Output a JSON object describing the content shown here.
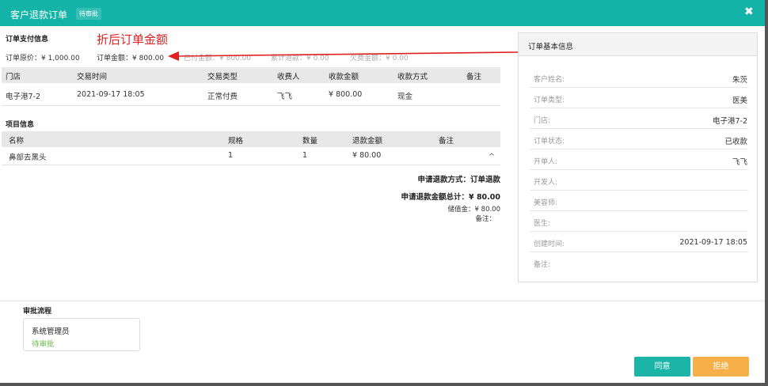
{
  "header": {
    "title": "客户退款订单",
    "badge": "待审批",
    "close": "✖"
  },
  "annotation": "折后订单金额",
  "payment": {
    "section_title": "订单支付信息",
    "original_price": "订单原价：¥ 1,000.00",
    "order_amount": "订单金额：¥ 800.00",
    "ghost_1": "已付金额：¥ 800.00",
    "ghost_2": "累计退款：¥ 0.00",
    "ghost_3": "欠费金额：¥ 0.00"
  },
  "transactions": {
    "columns": [
      "门店",
      "交易时间",
      "交易类型",
      "收费人",
      "收款金额",
      "收款方式",
      "备注"
    ],
    "rows": [
      {
        "store": "电子港7-2",
        "time": "2021-09-17 18:05",
        "type": "正常付费",
        "cashier": "飞飞",
        "amount": "¥ 800.00",
        "method": "现金",
        "note": ""
      }
    ]
  },
  "items": {
    "section_title": "项目信息",
    "columns": [
      "名称",
      "规格",
      "数量",
      "退款金额",
      "备注"
    ],
    "rows": [
      {
        "name": "鼻部去黑头",
        "spec": "1",
        "qty": "1",
        "refund": "¥ 80.00",
        "note": ""
      }
    ],
    "expand_icon": "^"
  },
  "summary": {
    "method": "申请退款方式：订单退款",
    "total": "申请退款金额总计：¥ 80.00",
    "stored_value": "储值金：¥ 80.00",
    "remark": "备注："
  },
  "basic_info": {
    "title": "订单基本信息",
    "rows": [
      {
        "label": "客户姓名:",
        "value": "朱茨"
      },
      {
        "label": "订单类型:",
        "value": "医美"
      },
      {
        "label": "门店:",
        "value": "电子港7-2"
      },
      {
        "label": "订单状态:",
        "value": "已收款"
      },
      {
        "label": "开单人:",
        "value": "飞飞"
      },
      {
        "label": "开发人:",
        "value": ""
      },
      {
        "label": "美容师:",
        "value": ""
      },
      {
        "label": "医生:",
        "value": ""
      },
      {
        "label": "创建时间:",
        "value": "2021-09-17 18:05"
      },
      {
        "label": "备注:",
        "value": ""
      }
    ]
  },
  "approval": {
    "section_title": "审批流程",
    "approver": "系统管理员",
    "status": "待审批"
  },
  "buttons": {
    "agree": "同意",
    "reject": "拒绝"
  },
  "colors": {
    "header": "#13b3a7",
    "agree": "#1bb5a8",
    "reject": "#f6b04a",
    "annotation": "#e02020",
    "pending": "#6bb94a"
  }
}
